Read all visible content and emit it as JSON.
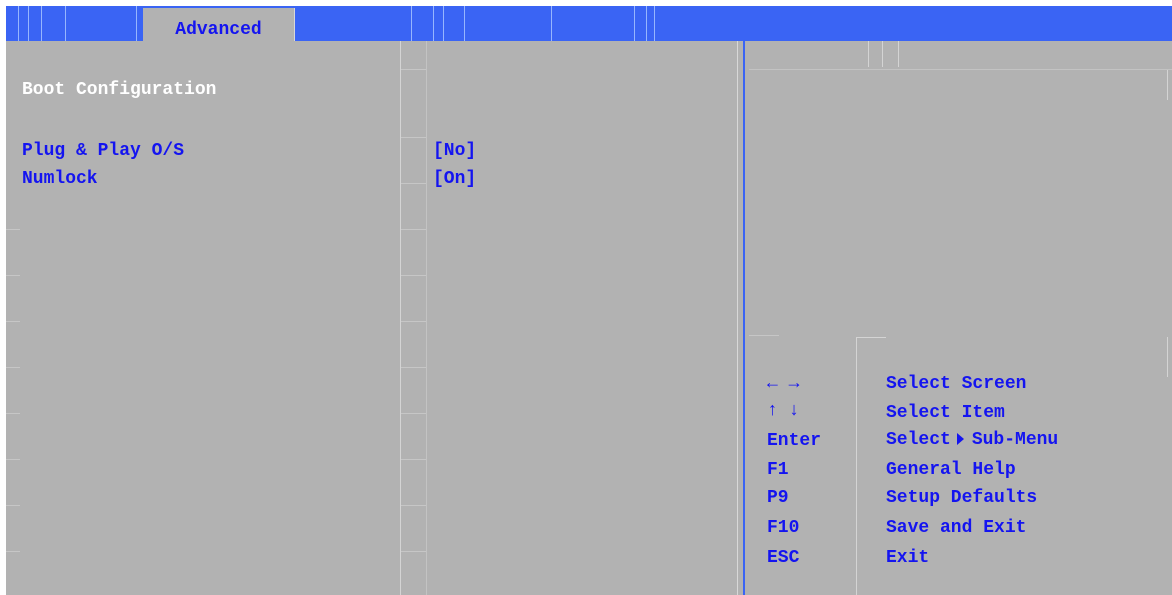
{
  "menu": {
    "active_tab": "Advanced"
  },
  "main": {
    "section_title": "Boot Configuration",
    "settings": [
      {
        "label": "Plug & Play O/S",
        "value": "[No]"
      },
      {
        "label": "Numlock",
        "value": "[On]"
      }
    ]
  },
  "help": {
    "keys": [
      {
        "key": "← →",
        "desc": "Select Screen"
      },
      {
        "key": "↑ ↓",
        "desc": "Select Item"
      },
      {
        "key": "Enter",
        "desc_before": "Select",
        "desc_icon": "triangle-right-icon",
        "desc_after": "Sub-Menu"
      },
      {
        "key": "F1",
        "desc": "General Help"
      },
      {
        "key": "P9",
        "desc": "Setup Defaults"
      },
      {
        "key": "F10",
        "desc": "Save and Exit"
      },
      {
        "key": "ESC",
        "desc": "Exit"
      }
    ]
  },
  "colors": {
    "menu_bar": "#3a64f4",
    "panel": "#b2b2b2",
    "text": "#1414f0",
    "section_title": "#ffffff"
  }
}
